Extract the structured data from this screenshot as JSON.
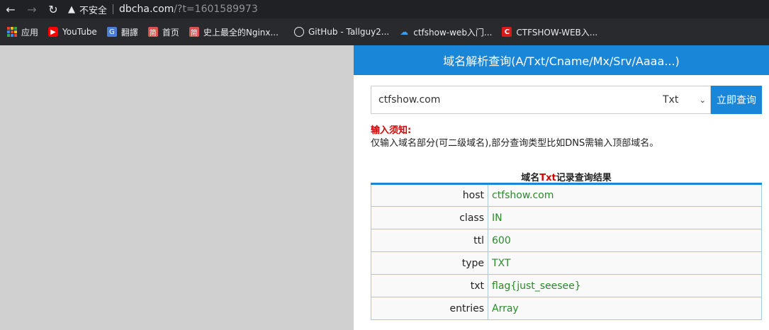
{
  "browser": {
    "back_icon": "arrow-left-icon",
    "forward_icon": "arrow-right-icon",
    "reload_icon": "reload-icon",
    "security_label": "不安全",
    "url_host": "dbcha.com",
    "url_path": "/?t=1601589973"
  },
  "bookmarks": [
    {
      "label": "应用",
      "icon": "apps-icon"
    },
    {
      "label": "YouTube",
      "icon": "youtube-icon"
    },
    {
      "label": "翻譯",
      "icon": "translate-icon"
    },
    {
      "label": "首页",
      "icon": "jian-icon"
    },
    {
      "label": "史上最全的Nginx...",
      "icon": "jian-icon"
    },
    {
      "label": "GitHub - Tallguy2...",
      "icon": "github-icon"
    },
    {
      "label": "ctfshow-web入门...",
      "icon": "cloud-icon"
    },
    {
      "label": "CTFSHOW-WEB入...",
      "icon": "c-icon"
    }
  ],
  "page": {
    "header_title": "域名解析查询(A/Txt/Cname/Mx/Srv/Aaaa...)",
    "query_value": "ctfshow.com",
    "record_type": "Txt",
    "query_button": "立即查询",
    "notice_title": "输入须知:",
    "notice_body": "仅输入域名部分(可二级域名),部分查询类型比如DNS需输入顶部域名。",
    "result_title_prefix": "域名",
    "result_title_type": "Txt",
    "result_title_suffix": "记录查询结果",
    "results": [
      {
        "key": "host",
        "value": "ctfshow.com"
      },
      {
        "key": "class",
        "value": "IN"
      },
      {
        "key": "ttl",
        "value": "600"
      },
      {
        "key": "type",
        "value": "TXT"
      },
      {
        "key": "txt",
        "value": "flag{just_seesee}"
      },
      {
        "key": "entries",
        "value": "Array"
      }
    ]
  },
  "colors": {
    "accent": "#1a86d8",
    "warning": "#d40000",
    "result_value": "#2a8a2a"
  }
}
